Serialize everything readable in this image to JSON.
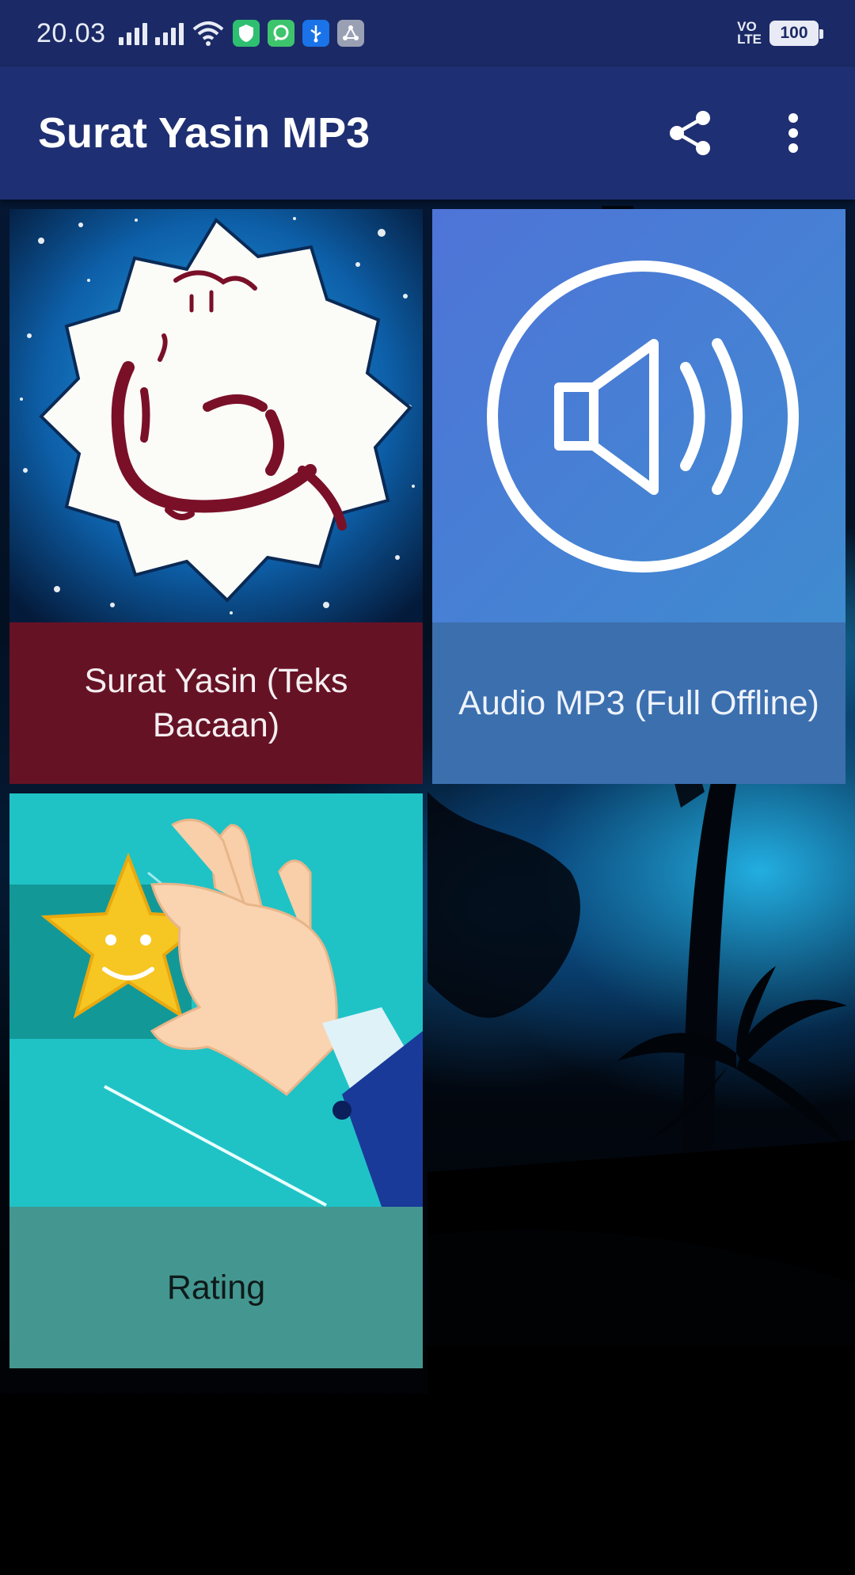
{
  "status_bar": {
    "time": "20.03",
    "network": "VO\nLTE",
    "battery": "100"
  },
  "app_bar": {
    "title": "Surat Yasin MP3",
    "share_icon": "share-icon",
    "menu_icon": "more-vert-icon"
  },
  "menu": {
    "items": [
      {
        "label": "Surat Yasin (Teks Bacaan)",
        "icon": "yasin-calligraphy-image",
        "color": "#661225"
      },
      {
        "label": "Audio MP3 (Full Offline)",
        "icon": "speaker-icon",
        "color": "#3c6fae"
      },
      {
        "label": "Rating",
        "icon": "star-rating-image",
        "color": "#449790"
      }
    ]
  },
  "colors": {
    "status_bar": "#1b2a66",
    "app_bar": "#1f2f73"
  }
}
